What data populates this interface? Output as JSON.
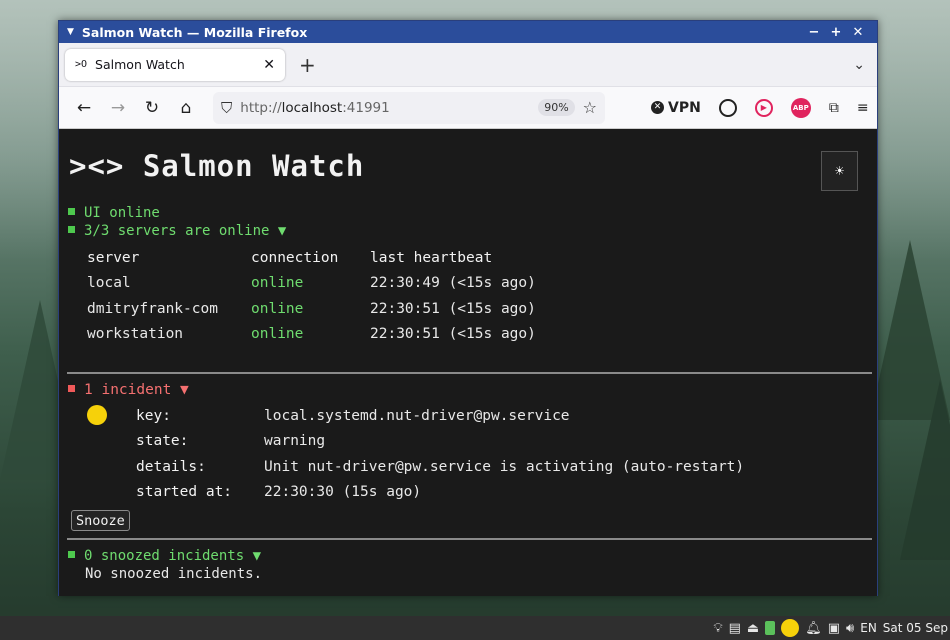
{
  "window": {
    "title": "Salmon Watch — Mozilla Firefox",
    "min_glyph": "−",
    "max_glyph": "+",
    "close_glyph": "✕"
  },
  "tabs": [
    {
      "favicon": ">O",
      "label": "Salmon Watch",
      "close_glyph": "✕"
    }
  ],
  "toolbar": {
    "new_tab_glyph": "+",
    "tab_list_glyph": "⌄",
    "back_glyph": "←",
    "forward_glyph": "→",
    "reload_glyph": "↻",
    "home_glyph": "⌂",
    "url_scheme": "http://",
    "url_host": "localhost",
    "url_port": ":41991",
    "zoom": "90%",
    "bookmark_glyph": "☆",
    "vpn_label": "VPN",
    "abp_label": "ABP",
    "extensions_glyph": "⧉",
    "menu_glyph": "≡"
  },
  "page": {
    "title": "><> Salmon Watch",
    "theme_toggle_glyph": "☀",
    "ui_status": "UI online",
    "servers_status": "3/3 servers are online ▼",
    "server_table": {
      "headers": [
        "server",
        "connection",
        "last heartbeat"
      ],
      "rows": [
        {
          "server": "local",
          "connection": "online",
          "heartbeat": "22:30:49 (<15s ago)"
        },
        {
          "server": "dmitryfrank-com",
          "connection": "online",
          "heartbeat": "22:30:51 (<15s ago)"
        },
        {
          "server": "workstation",
          "connection": "online",
          "heartbeat": "22:30:51 (<15s ago)"
        }
      ]
    },
    "incidents_status": "1 incident ▼",
    "incident": {
      "fields": [
        {
          "key": "key:",
          "value": "local.systemd.nut-driver@pw.service"
        },
        {
          "key": "state:",
          "value": "warning"
        },
        {
          "key": "details:",
          "value": "Unit nut-driver@pw.service is activating (auto-restart)"
        },
        {
          "key": "started at:",
          "value": "22:30:30 (15s ago)"
        }
      ],
      "snooze_label": "Snooze"
    },
    "snoozed_status": "0 snoozed incidents ▼",
    "snoozed_empty": "No snoozed incidents."
  },
  "taskbar": {
    "language": "EN",
    "clock": "Sat 05 Sep"
  },
  "colors": {
    "titlebar": "#2b4d9b",
    "page_bg": "#1a1a1a",
    "ok_green": "#6fdc6f",
    "incident_red": "#f47070",
    "warning_yellow": "#f6d10a"
  }
}
